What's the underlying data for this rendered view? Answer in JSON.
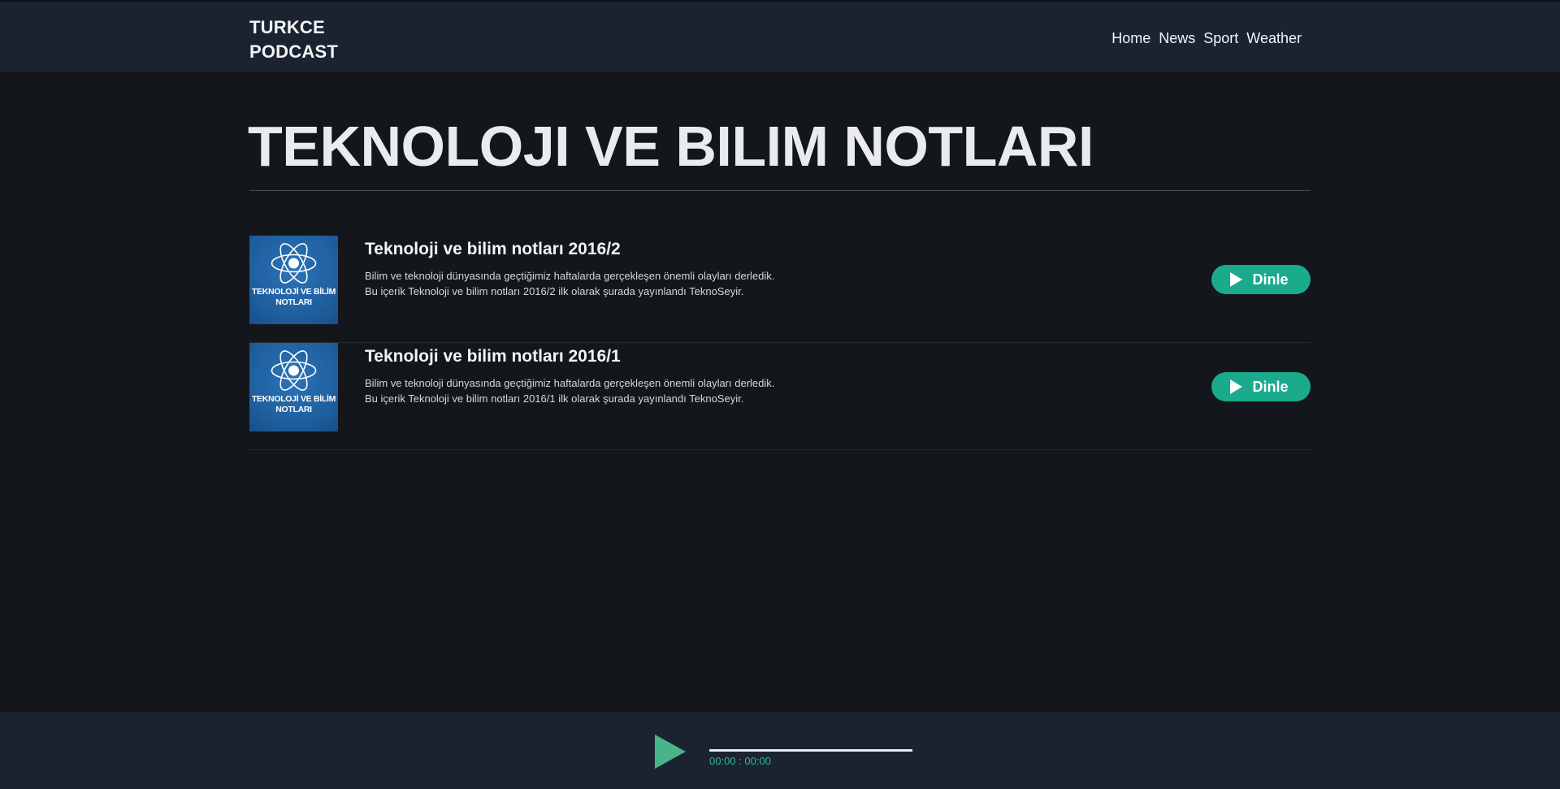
{
  "header": {
    "brand_line1": "TURKCE",
    "brand_line2": "PODCAST",
    "nav": [
      "Home",
      "News",
      "Sport",
      "Weather"
    ]
  },
  "page_title": "TEKNOLOJI VE BILIM NOTLARI",
  "episodes": [
    {
      "thumb_line1": "TEKNOLOJİ VE BİLİM",
      "thumb_line2": "NOTLARI",
      "title": "Teknoloji ve bilim notları 2016/2",
      "desc_line1": "Bilim ve teknoloji dünyasında geçtiğimiz haftalarda gerçekleşen önemli olayları derledik.",
      "desc_line2": "Bu içerik Teknoloji ve bilim notları 2016/2 ilk olarak şurada yayınlandı TeknoSeyir.",
      "button_label": "Dinle"
    },
    {
      "thumb_line1": "TEKNOLOJİ VE BİLİM",
      "thumb_line2": "NOTLARI",
      "title": "Teknoloji ve bilim notları 2016/1",
      "desc_line1": "Bilim ve teknoloji dünyasında geçtiğimiz haftalarda gerçekleşen önemli olayları derledik.",
      "desc_line2": "Bu içerik Teknoloji ve bilim notları 2016/1 ilk olarak şurada yayınlandı TeknoSeyir.",
      "button_label": "Dinle"
    }
  ],
  "player": {
    "time": "00:00 : 00:00",
    "progress": 0
  },
  "colors": {
    "accent": "#1aaa8c",
    "player_accent": "#49b48a",
    "background": "#13161b",
    "bar": "#1b2331"
  },
  "icons": {
    "play": "play-icon",
    "atom": "atom-icon"
  }
}
